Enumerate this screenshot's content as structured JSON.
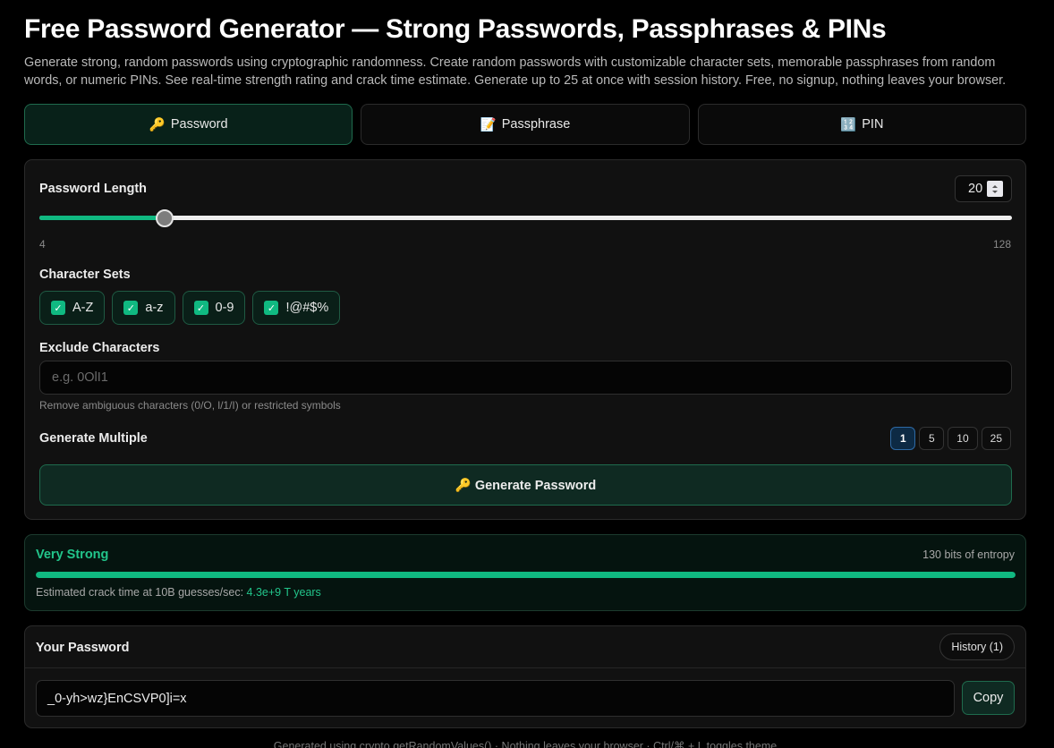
{
  "page": {
    "title": "Free Password Generator — Strong Passwords, Passphrases & PINs",
    "description": "Generate strong, random passwords using cryptographic randomness. Create random passwords with customizable character sets, memorable passphrases from random words, or numeric PINs. See real-time strength rating and crack time estimate. Generate up to 25 at once with session history. Free, no signup, nothing leaves your browser."
  },
  "tabs": [
    {
      "icon": "🔑",
      "icon_name": "key-icon",
      "label": "Password",
      "active": true
    },
    {
      "icon": "📝",
      "icon_name": "memo-icon",
      "label": "Passphrase",
      "active": false
    },
    {
      "icon": "🔢",
      "icon_name": "numbers-icon",
      "label": "PIN",
      "active": false
    }
  ],
  "length": {
    "label": "Password Length",
    "value": "20",
    "min": "4",
    "max": "128",
    "current": 20
  },
  "charsets": {
    "label": "Character Sets",
    "items": [
      {
        "label": "A-Z",
        "checked": true
      },
      {
        "label": "a-z",
        "checked": true
      },
      {
        "label": "0-9",
        "checked": true
      },
      {
        "label": "!@#$%",
        "checked": true
      }
    ]
  },
  "exclude": {
    "label": "Exclude Characters",
    "placeholder": "e.g. 0OlI1",
    "hint": "Remove ambiguous characters (0/O, l/1/I) or restricted symbols"
  },
  "multiple": {
    "label": "Generate Multiple",
    "options": [
      "1",
      "5",
      "10",
      "25"
    ],
    "selected": "1"
  },
  "generate": {
    "label": "🔑 Generate Password"
  },
  "strength": {
    "rating": "Very Strong",
    "bits": "130 bits of entropy",
    "fill_fraction": 1.0,
    "crack_prefix": "Estimated crack time at 10B guesses/sec:",
    "crack_value": "4.3e+9 T years"
  },
  "result": {
    "title": "Your Password",
    "history_label": "History (1)",
    "password": "_0-yh>wz}EnCSVP0]i=x",
    "copy_label": "Copy"
  },
  "footer": "Generated using crypto.getRandomValues() · Nothing leaves your browser · Ctrl/⌘ + L toggles theme",
  "colors": {
    "accent": "#10b981",
    "accent_text": "#22c58b",
    "background": "#000000"
  }
}
